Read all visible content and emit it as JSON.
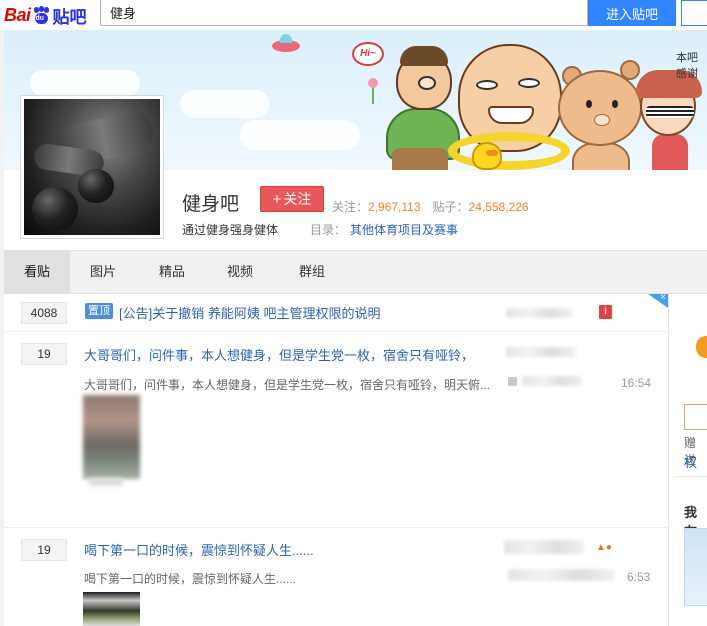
{
  "topbar": {
    "logo_bai": "Bai",
    "logo_du": "du",
    "logo_tieba": "贴吧",
    "search_value": "健身",
    "search_button": "进入贴吧"
  },
  "banner": {
    "bubble_text": "Hi~",
    "note_line1": "本吧",
    "note_line2": "感谢"
  },
  "forum": {
    "name": "健身吧",
    "follow_label": "关注",
    "follow_plus": "+",
    "followers_label": "关注：",
    "followers_value": "2,967,113",
    "posts_label": "贴子：",
    "posts_value": "24,558,226",
    "slogan": "通过健身强身健体",
    "catalog_label": "目录：",
    "catalog_value": "其他体育项目及赛事"
  },
  "tabs": [
    {
      "label": "看贴",
      "active": true
    },
    {
      "label": "图片",
      "active": false
    },
    {
      "label": "精品",
      "active": false
    },
    {
      "label": "视频",
      "active": false
    },
    {
      "label": "群组",
      "active": false
    }
  ],
  "threads": [
    {
      "replies": "4088",
      "badge": "置顶",
      "title": "[公告]关于撤销 养能阿姨 吧主管理权限的说明",
      "icon": "info-icon"
    },
    {
      "replies": "19",
      "title": "大哥哥们，问件事，本人想健身，但是学生党一枚，宿舍只有哑铃，",
      "abstract": "大哥哥们，问件事，本人想健身，但是学生党一枚，宿舍只有哑铃，明天俯...",
      "time": "16:54"
    },
    {
      "replies": "19",
      "title": "喝下第一口的时候，震惊到怀疑人生......",
      "abstract": "喝下第一口的时候，震惊到怀疑人生......",
      "time": "6:53"
    }
  ],
  "sidebar": {
    "text1": "赠送",
    "text2": "权",
    "heading": "我在"
  },
  "colors": {
    "accent_blue": "#3385ff",
    "link_blue": "#2d64b3",
    "follow_red": "#e85858",
    "stat_orange": "#f57d28"
  }
}
